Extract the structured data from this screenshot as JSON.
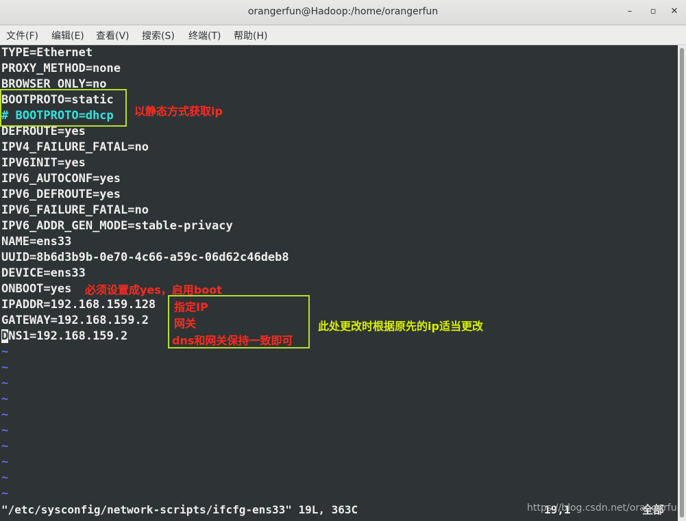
{
  "window": {
    "title": "orangerfun@Hadoop:/home/orangerfun",
    "controls": [
      "minimize",
      "maximize",
      "close"
    ]
  },
  "menu": [
    "文件(F)",
    "编辑(E)",
    "查看(V)",
    "搜索(S)",
    "终端(T)",
    "帮助(H)"
  ],
  "file_lines": [
    "TYPE=Ethernet",
    "PROXY_METHOD=none",
    "BROWSER_ONLY=no",
    "BOOTPROTO=static",
    "# BOOTPROTO=dhcp",
    "DEFROUTE=yes",
    "IPV4_FAILURE_FATAL=no",
    "IPV6INIT=yes",
    "IPV6_AUTOCONF=yes",
    "IPV6_DEFROUTE=yes",
    "IPV6_FAILURE_FATAL=no",
    "IPV6_ADDR_GEN_MODE=stable-privacy",
    "NAME=ens33",
    "UUID=8b6d3b9b-0e70-4c66-a59c-06d62c46deb8",
    "DEVICE=ens33",
    "ONBOOT=yes",
    "IPADDR=192.168.159.128",
    "GATEWAY=192.168.159.2",
    "DNS1=192.168.159.2"
  ],
  "cursor_char": "D",
  "dns_rest": "NS1=192.168.159.2",
  "tilde": "~",
  "status_line": "\"/etc/sysconfig/network-scripts/ifcfg-ens33\" 19L, 363C",
  "position": "19,1",
  "position_label": "全部",
  "annotations": {
    "bootproto": "以静态方式获取ip",
    "onboot": "必须设置成yes，启用boot",
    "ip": "指定IP",
    "gateway": "网关",
    "dns": "dns和网关保持一致即可",
    "note": "此处更改时根据原先的ip适当更改"
  },
  "watermark": "https://blog.csdn.net/orangerfun",
  "colors": {
    "terminal_bg": "#2e3436",
    "text": "#eeeeec",
    "comment": "#34e2e2",
    "tilde": "#5f6cf0",
    "highlight_box": "#b6e02a",
    "annotation_red": "#ff2a1f",
    "annotation_yellow": "#d9f000"
  }
}
